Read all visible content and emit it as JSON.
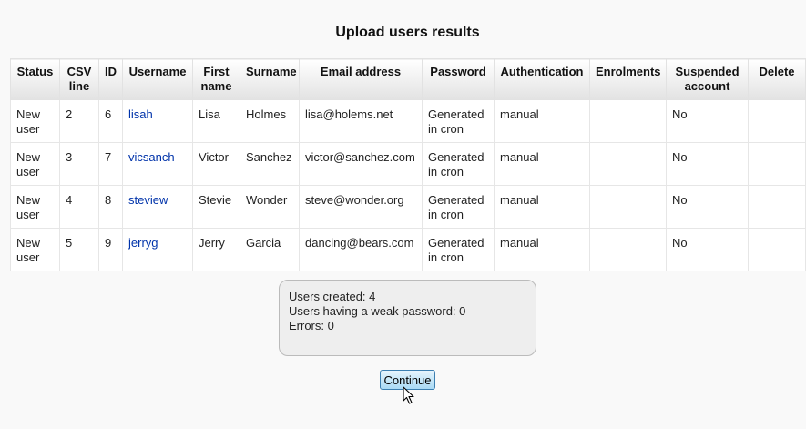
{
  "page": {
    "title": "Upload users results"
  },
  "table": {
    "headers": [
      "Status",
      "CSV line",
      "ID",
      "Username",
      "First name",
      "Surname",
      "Email address",
      "Password",
      "Authentication",
      "Enrolments",
      "Suspended account",
      "Delete"
    ],
    "rows": [
      {
        "status": "New user",
        "csv_line": "2",
        "id": "6",
        "username": "lisah",
        "first_name": "Lisa",
        "surname": "Holmes",
        "email": "lisa@holems.net",
        "password": "Generated in cron",
        "authentication": "manual",
        "enrolments": "",
        "suspended": "No",
        "delete": ""
      },
      {
        "status": "New user",
        "csv_line": "3",
        "id": "7",
        "username": "vicsanch",
        "first_name": "Victor",
        "surname": "Sanchez",
        "email": "victor@sanchez.com",
        "password": "Generated in cron",
        "authentication": "manual",
        "enrolments": "",
        "suspended": "No",
        "delete": ""
      },
      {
        "status": "New user",
        "csv_line": "4",
        "id": "8",
        "username": "steview",
        "first_name": "Stevie",
        "surname": "Wonder",
        "email": "steve@wonder.org",
        "password": "Generated in cron",
        "authentication": "manual",
        "enrolments": "",
        "suspended": "No",
        "delete": ""
      },
      {
        "status": "New user",
        "csv_line": "5",
        "id": "9",
        "username": "jerryg",
        "first_name": "Jerry",
        "surname": "Garcia",
        "email": "dancing@bears.com",
        "password": "Generated in cron",
        "authentication": "manual",
        "enrolments": "",
        "suspended": "No",
        "delete": ""
      }
    ]
  },
  "summary": {
    "users_created": "Users created: 4",
    "weak_password": "Users having a weak password: 0",
    "errors": "Errors: 0"
  },
  "continue_label": "Continue",
  "colors": {
    "link": "#0033aa",
    "button_border": "#3c7fb1",
    "button_fill": "#a9daf5"
  },
  "icons": {
    "cursor": "mouse-pointer-icon"
  }
}
